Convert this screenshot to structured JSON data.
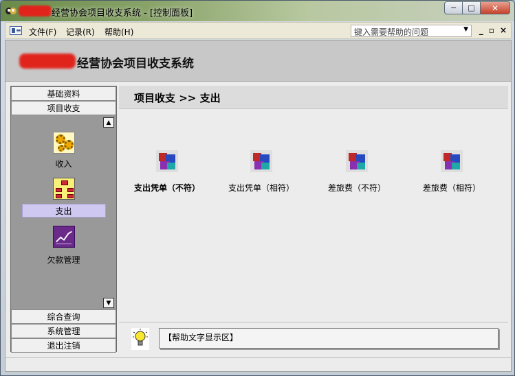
{
  "window": {
    "title": "经营协会项目收支系统 - [控制面板]",
    "buttons": {
      "minimize": "─",
      "maximize": "□",
      "close": "✕"
    }
  },
  "menu": {
    "items": [
      "文件(F)",
      "记录(R)",
      "帮助(H)"
    ],
    "help_placeholder": "键入需要帮助的问题",
    "mdi_buttons": [
      "_",
      "▫",
      "×"
    ]
  },
  "header": {
    "title": "经营协会项目收支系统"
  },
  "nav": {
    "top_tabs": [
      "基础资料",
      "项目收支"
    ],
    "entries": [
      {
        "label": "收入",
        "icon": "gears-icon",
        "active": false
      },
      {
        "label": "支出",
        "icon": "org-chart-icon",
        "active": true
      },
      {
        "label": "欠款管理",
        "icon": "trend-chart-icon",
        "active": false
      }
    ],
    "bottom_tabs": [
      "综合查询",
      "系统管理",
      "退出注销"
    ],
    "scroll_up": "▲",
    "scroll_down": "▼"
  },
  "main": {
    "breadcrumb": "项目收支 >> 支出",
    "actions": [
      {
        "label": "支出凭单（不符）",
        "icon": "cubes-icon"
      },
      {
        "label": "支出凭单（相符）",
        "icon": "cubes-icon"
      },
      {
        "label": "差旅费（不符）",
        "icon": "cubes-icon"
      },
      {
        "label": "差旅费（相符）",
        "icon": "cubes-icon"
      }
    ]
  },
  "helpbar": {
    "text": "【帮助文字显示区】",
    "icon": "lightbulb-icon"
  }
}
